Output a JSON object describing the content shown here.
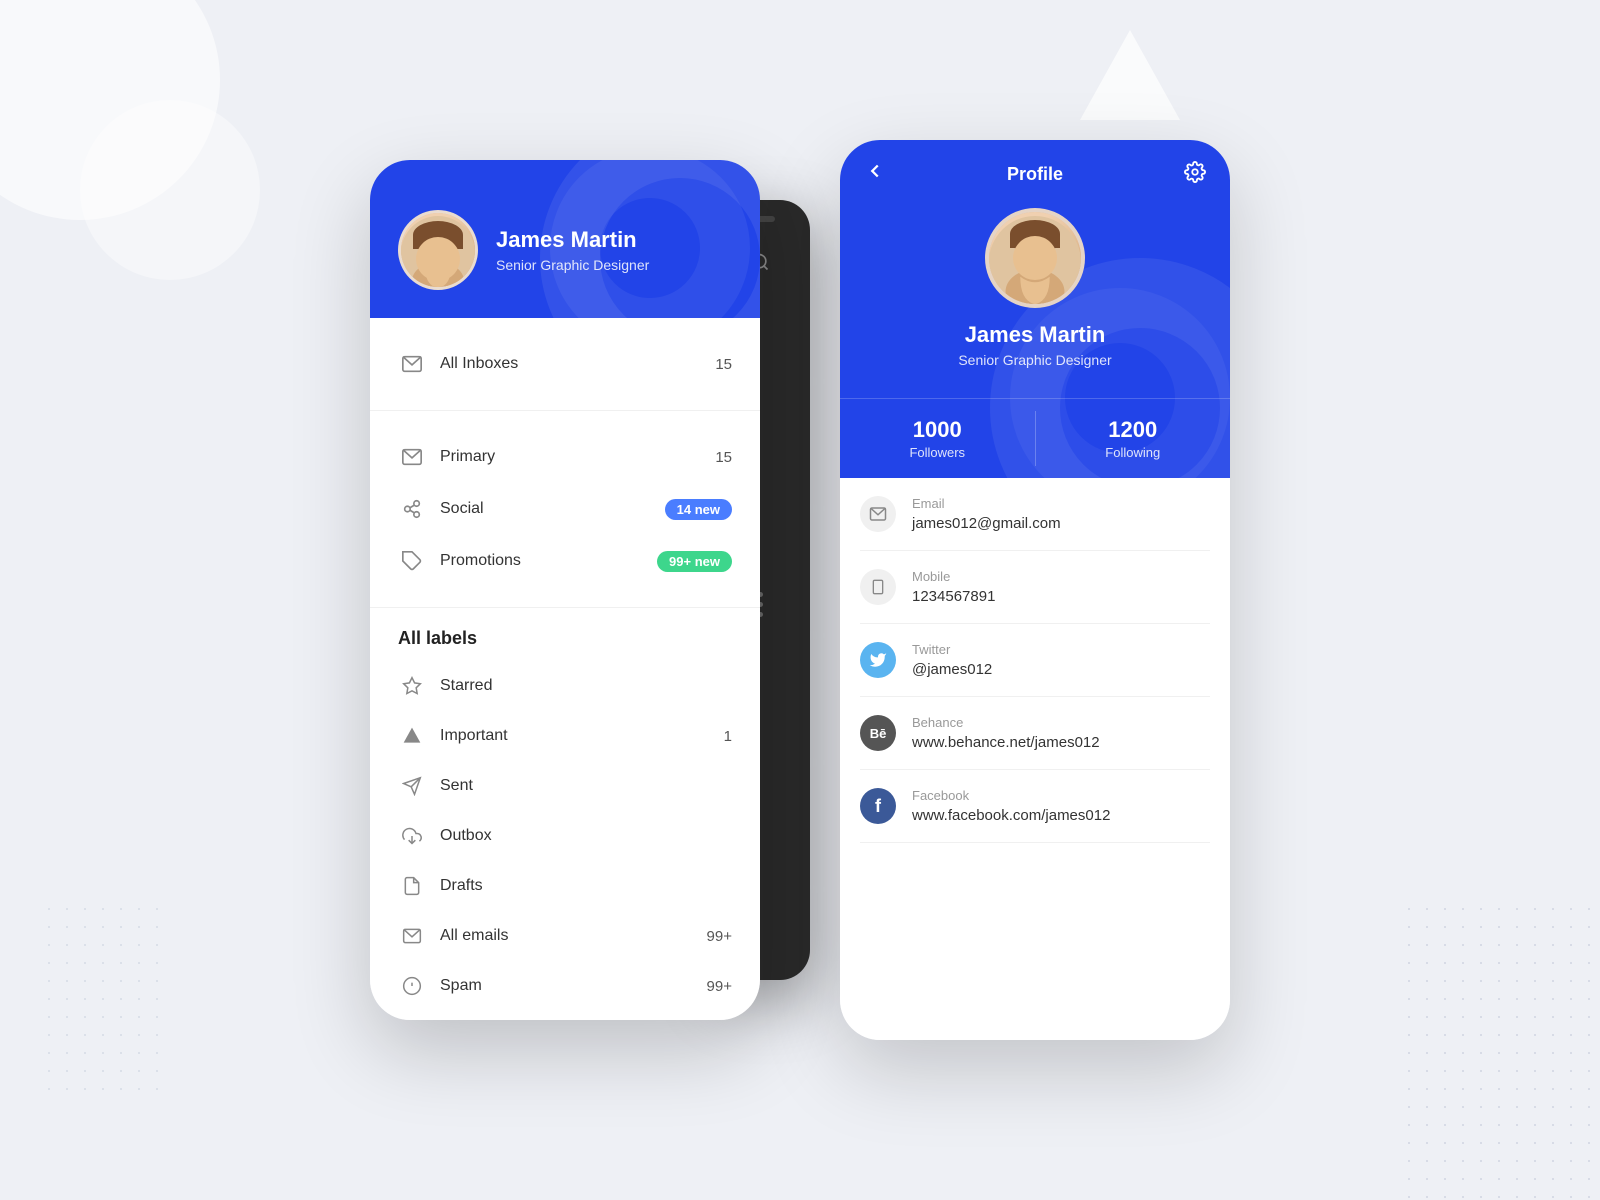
{
  "background": {
    "color": "#eef0f5"
  },
  "phone1": {
    "header": {
      "user_name": "James Martin",
      "user_title": "Senior Graphic Designer"
    },
    "inbox": {
      "section_divider": true,
      "items": [
        {
          "label": "All Inboxes",
          "count": "15",
          "badge": null,
          "icon": "inbox-icon"
        }
      ],
      "categories": [
        {
          "label": "Primary",
          "count": "15",
          "badge": null,
          "icon": "email-icon"
        },
        {
          "label": "Social",
          "count": null,
          "badge": "14 new",
          "badge_type": "blue",
          "icon": "social-icon"
        },
        {
          "label": "Promotions",
          "count": null,
          "badge": "99+ new",
          "badge_type": "green",
          "icon": "tag-icon"
        }
      ]
    },
    "labels": {
      "title": "All labels",
      "items": [
        {
          "label": "Starred",
          "count": null,
          "icon": "star-icon"
        },
        {
          "label": "Important",
          "count": "1",
          "icon": "important-icon"
        },
        {
          "label": "Sent",
          "count": null,
          "icon": "sent-icon"
        },
        {
          "label": "Outbox",
          "count": null,
          "icon": "outbox-icon"
        },
        {
          "label": "Drafts",
          "count": null,
          "icon": "drafts-icon"
        },
        {
          "label": "All emails",
          "count": "99+",
          "icon": "all-email-icon"
        },
        {
          "label": "Spam",
          "count": "99+",
          "icon": "spam-icon"
        }
      ]
    }
  },
  "phone2": {
    "header_title": "Profile",
    "back_label": "←",
    "settings_label": "⚙",
    "user_name": "James Martin",
    "user_title": "Senior Graphic Designer",
    "stats": {
      "followers_count": "1000",
      "followers_label": "Followers",
      "following_count": "1200",
      "following_label": "Following"
    },
    "contacts": [
      {
        "type": "email",
        "label": "Email",
        "value": "james012@gmail.com",
        "icon_label": "✉"
      },
      {
        "type": "mobile",
        "label": "Mobile",
        "value": "1234567891",
        "icon_label": "📱"
      },
      {
        "type": "twitter",
        "label": "Twitter",
        "value": "@james012",
        "icon_label": "🐦"
      },
      {
        "type": "behance",
        "label": "Behance",
        "value": "www.behance.net/james012",
        "icon_label": "Bē"
      },
      {
        "type": "facebook",
        "label": "Facebook",
        "value": "www.facebook.com/james012",
        "icon_label": "f"
      }
    ]
  }
}
